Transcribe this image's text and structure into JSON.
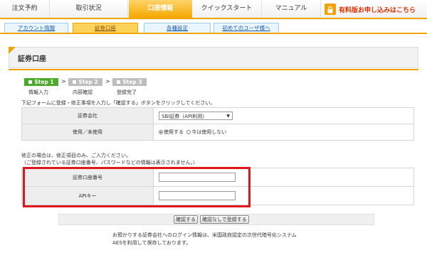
{
  "nav": {
    "items": [
      "注文予約",
      "取引状況",
      "口座情報",
      "クイックスタート",
      "マニュアル"
    ],
    "active_index": 2,
    "promo_text": "有料版お申し込みはこちら",
    "promo_icon": "lock-icon"
  },
  "subtabs": {
    "items": [
      "アカウント情報",
      "証券口座",
      "各種設定",
      "初めてのユーザ様へ"
    ],
    "active_index": 1
  },
  "page": {
    "title": "証券口座"
  },
  "steps": [
    {
      "badge": "Step 1",
      "label": "情報入力",
      "state": "current"
    },
    {
      "badge": "Step 2",
      "label": "内容確認",
      "state": "pending"
    },
    {
      "badge": "Step 3",
      "label": "登録完了",
      "state": "pending"
    }
  ],
  "step_arrow": ">",
  "instructions": "下記フォームに登録・修正事項を入力し「確認する」ボタンをクリックしてください。",
  "form1": {
    "broker_label": "証券会社",
    "broker_value": "SBI証券（API利用）",
    "usage_label": "使用／未使用",
    "use_option": "使用する",
    "nouse_option": "今は使用しない",
    "selected": "use"
  },
  "note": {
    "line1": "修正の場合は、修正項目のみ、ご入力ください。",
    "line2": "（ご登録されている証券口座番号、パスワードなどの情報は表示されません。）"
  },
  "form2": {
    "account_label": "証券口座番号",
    "account_value": "",
    "api_label": "APIキー",
    "api_value": ""
  },
  "buttons": {
    "confirm": "確認する",
    "register_direct": "確認なしで登録する"
  },
  "footer": {
    "line1": "お預かりする証券会社へのログイン情報は、米国政府認定の次世代暗号化システム",
    "line2": "AESを利用して保存しております。"
  },
  "colors": {
    "accent": "#f0a400",
    "step_active": "#4caa2a",
    "step_inactive": "#bdbdbd",
    "highlight": "#e0161b",
    "promo": "#e03000"
  }
}
